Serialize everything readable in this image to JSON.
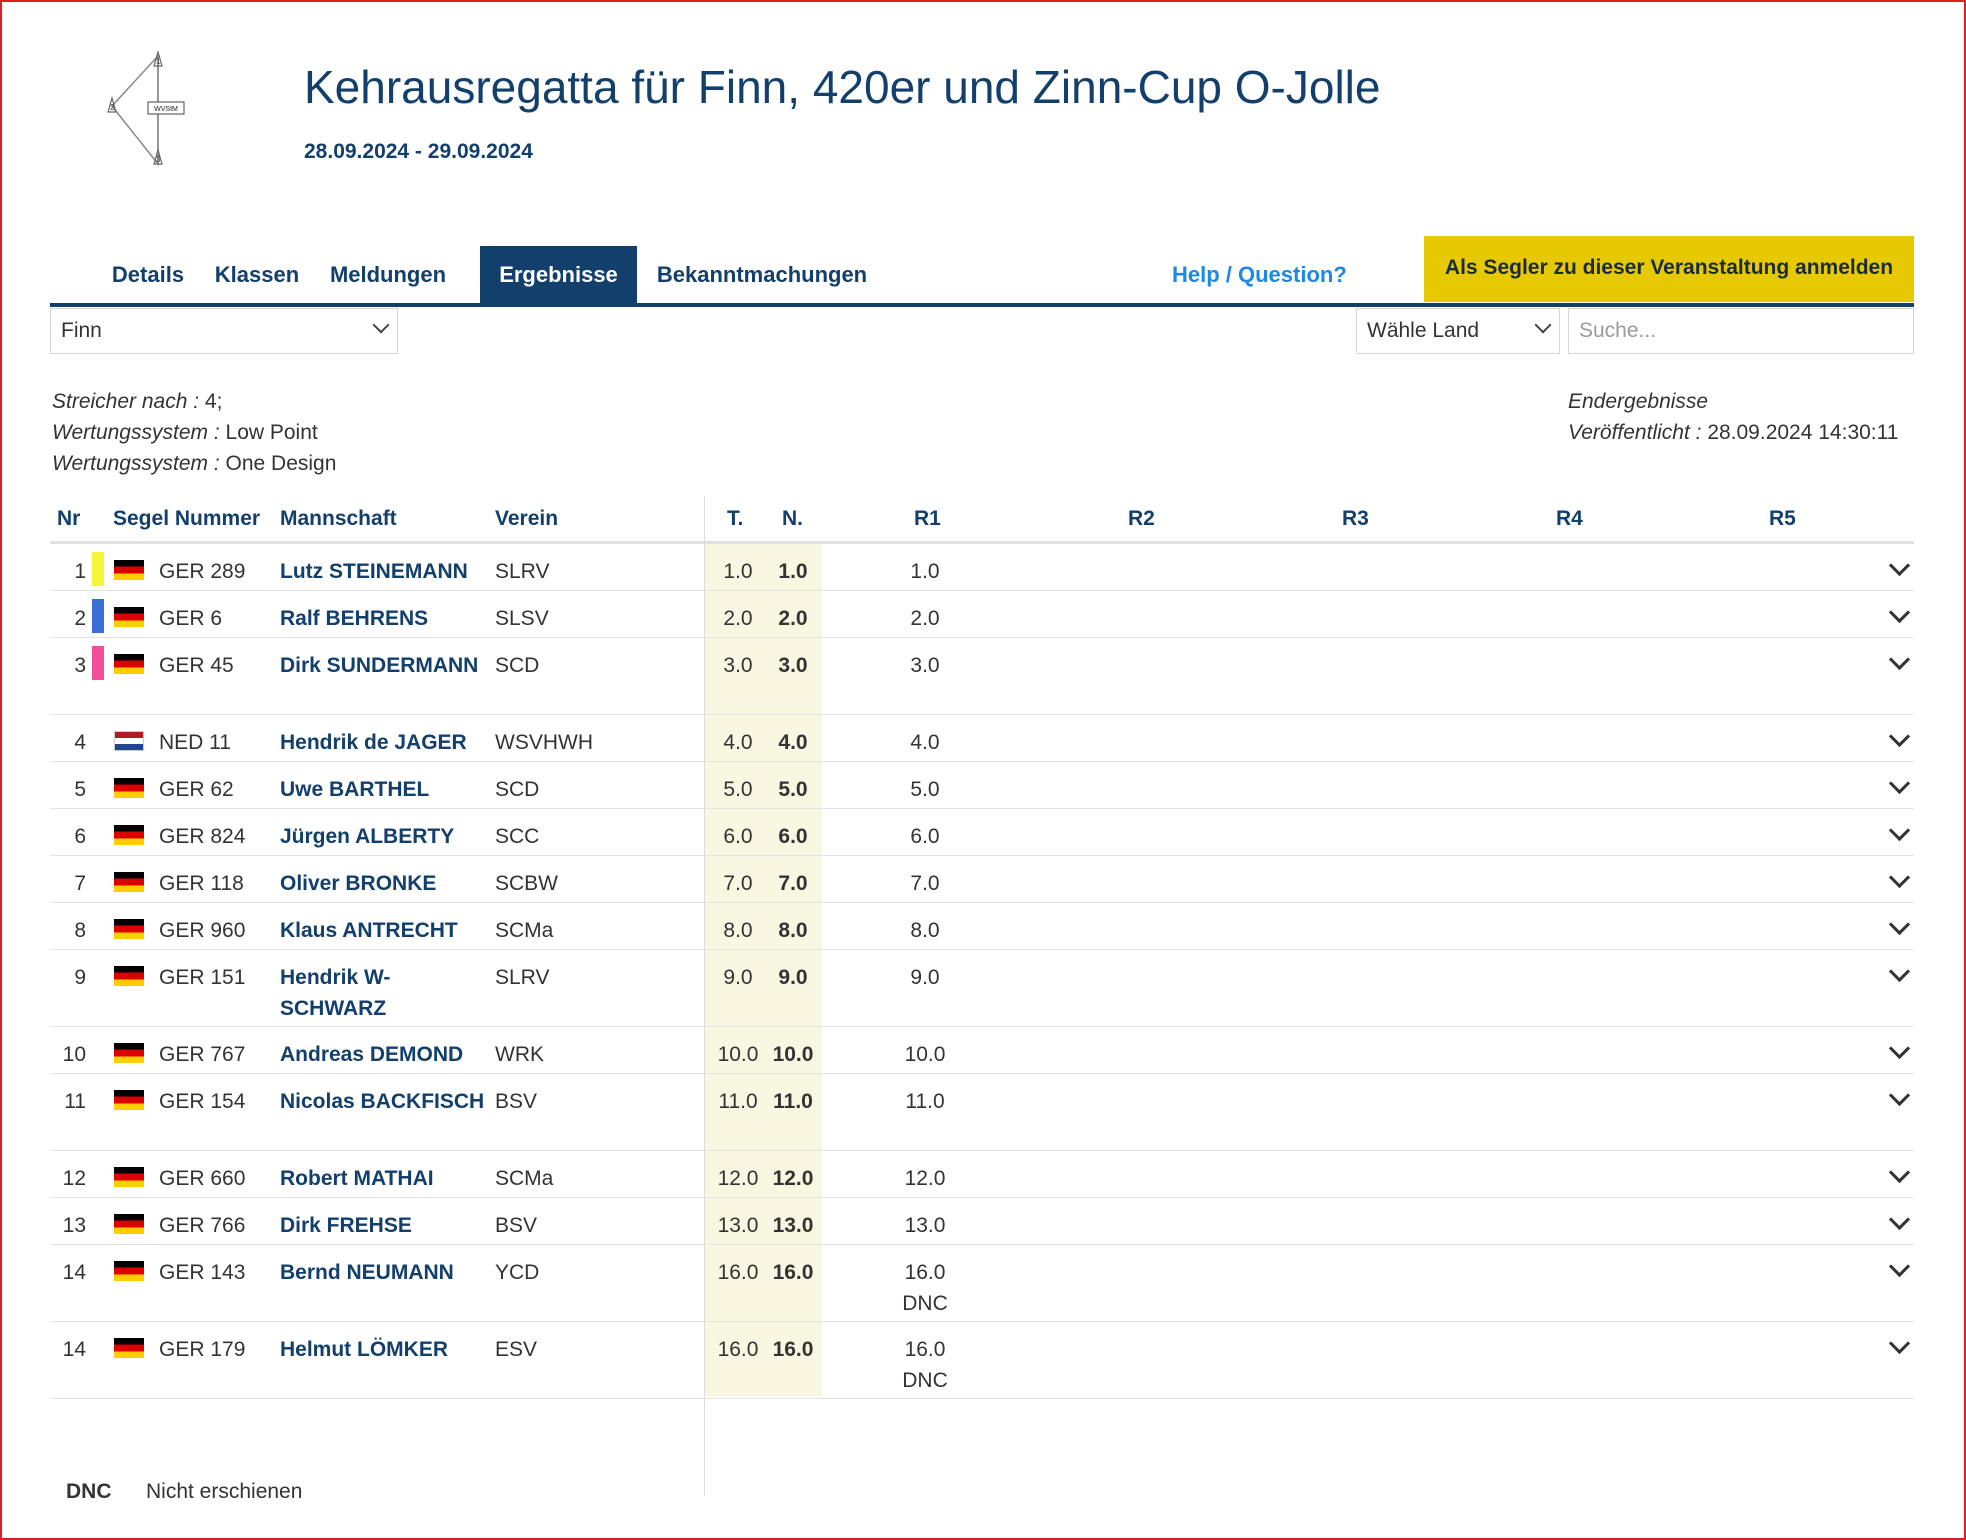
{
  "event": {
    "logo_text": "WVStM",
    "title": "Kehrausregatta für Finn, 420er und Zinn-Cup O-Jolle",
    "dates": "28.09.2024 - 29.09.2024"
  },
  "nav": {
    "tabs": [
      "Details",
      "Klassen",
      "Meldungen",
      "Ergebnisse",
      "Bekanntmachungen"
    ],
    "active_tab": "Ergebnisse",
    "help": "Help / Question?",
    "register": "Als Segler zu dieser Veranstaltung anmelden"
  },
  "filters": {
    "class_select": "Finn",
    "country_select": "Wähle Land",
    "search_placeholder": "Suche..."
  },
  "meta": {
    "discard_label": "Streicher nach :",
    "discard_value": "4;",
    "scoring_label": "Wertungssystem :",
    "scoring_value": "Low Point",
    "scoring2_label": "Wertungssystem :",
    "scoring2_value": "One Design",
    "status": "Endergebnisse",
    "published_label": "Veröffentlicht :",
    "published_value": "28.09.2024 14:30:11"
  },
  "table": {
    "headers": {
      "nr": "Nr",
      "sail": "Segel Nummer",
      "crew": "Mannschaft",
      "club": "Verein",
      "t": "T.",
      "n": "N.",
      "r1": "R1",
      "r2": "R2",
      "r3": "R3",
      "r4": "R4",
      "r5": "R5"
    },
    "rows": [
      {
        "nr": "1",
        "marker": "#f5f53a",
        "country": "GER",
        "sail": "GER 289",
        "name": "Lutz STEINEMANN",
        "club": "SLRV",
        "t": "1.0",
        "n": "1.0",
        "r1": "1.0",
        "r1_note": ""
      },
      {
        "nr": "2",
        "marker": "#3b6fd6",
        "country": "GER",
        "sail": "GER 6",
        "name": "Ralf BEHRENS",
        "club": "SLSV",
        "t": "2.0",
        "n": "2.0",
        "r1": "2.0",
        "r1_note": ""
      },
      {
        "nr": "3",
        "marker": "#f0509a",
        "country": "GER",
        "sail": "GER 45",
        "name": "Dirk SUNDERMANN",
        "club": "SCD",
        "t": "3.0",
        "n": "3.0",
        "r1": "3.0",
        "r1_note": ""
      },
      {
        "nr": "4",
        "marker": "",
        "country": "NED",
        "sail": "NED 11",
        "name": "Hendrik de JAGER",
        "club": "WSVHWH",
        "t": "4.0",
        "n": "4.0",
        "r1": "4.0",
        "r1_note": ""
      },
      {
        "nr": "5",
        "marker": "",
        "country": "GER",
        "sail": "GER 62",
        "name": "Uwe BARTHEL",
        "club": "SCD",
        "t": "5.0",
        "n": "5.0",
        "r1": "5.0",
        "r1_note": ""
      },
      {
        "nr": "6",
        "marker": "",
        "country": "GER",
        "sail": "GER 824",
        "name": "Jürgen ALBERTY",
        "club": "SCC",
        "t": "6.0",
        "n": "6.0",
        "r1": "6.0",
        "r1_note": ""
      },
      {
        "nr": "7",
        "marker": "",
        "country": "GER",
        "sail": "GER 118",
        "name": "Oliver BRONKE",
        "club": "SCBW",
        "t": "7.0",
        "n": "7.0",
        "r1": "7.0",
        "r1_note": ""
      },
      {
        "nr": "8",
        "marker": "",
        "country": "GER",
        "sail": "GER 960",
        "name": "Klaus ANTRECHT",
        "club": "SCMa",
        "t": "8.0",
        "n": "8.0",
        "r1": "8.0",
        "r1_note": ""
      },
      {
        "nr": "9",
        "marker": "",
        "country": "GER",
        "sail": "GER 151",
        "name": "Hendrik W-SCHWARZ",
        "club": "SLRV",
        "t": "9.0",
        "n": "9.0",
        "r1": "9.0",
        "r1_note": ""
      },
      {
        "nr": "10",
        "marker": "",
        "country": "GER",
        "sail": "GER 767",
        "name": "Andreas DEMOND",
        "club": "WRK",
        "t": "10.0",
        "n": "10.0",
        "r1": "10.0",
        "r1_note": ""
      },
      {
        "nr": "11",
        "marker": "",
        "country": "GER",
        "sail": "GER 154",
        "name": "Nicolas BACKFISCH",
        "club": "BSV",
        "t": "11.0",
        "n": "11.0",
        "r1": "11.0",
        "r1_note": ""
      },
      {
        "nr": "12",
        "marker": "",
        "country": "GER",
        "sail": "GER 660",
        "name": "Robert MATHAI",
        "club": "SCMa",
        "t": "12.0",
        "n": "12.0",
        "r1": "12.0",
        "r1_note": ""
      },
      {
        "nr": "13",
        "marker": "",
        "country": "GER",
        "sail": "GER 766",
        "name": "Dirk FREHSE",
        "club": "BSV",
        "t": "13.0",
        "n": "13.0",
        "r1": "13.0",
        "r1_note": ""
      },
      {
        "nr": "14",
        "marker": "",
        "country": "GER",
        "sail": "GER 143",
        "name": "Bernd NEUMANN",
        "club": "YCD",
        "t": "16.0",
        "n": "16.0",
        "r1": "16.0",
        "r1_note": "DNC"
      },
      {
        "nr": "14",
        "marker": "",
        "country": "GER",
        "sail": "GER 179",
        "name": "Helmut LÖMKER",
        "club": "ESV",
        "t": "16.0",
        "n": "16.0",
        "r1": "16.0",
        "r1_note": "DNC"
      }
    ]
  },
  "legend": {
    "code": "DNC",
    "text": "Nicht erschienen"
  },
  "colors": {
    "primary": "#123f6b",
    "link": "#1e88e5",
    "register_bg": "#e6c900",
    "score_band": "#f8f7e1"
  }
}
